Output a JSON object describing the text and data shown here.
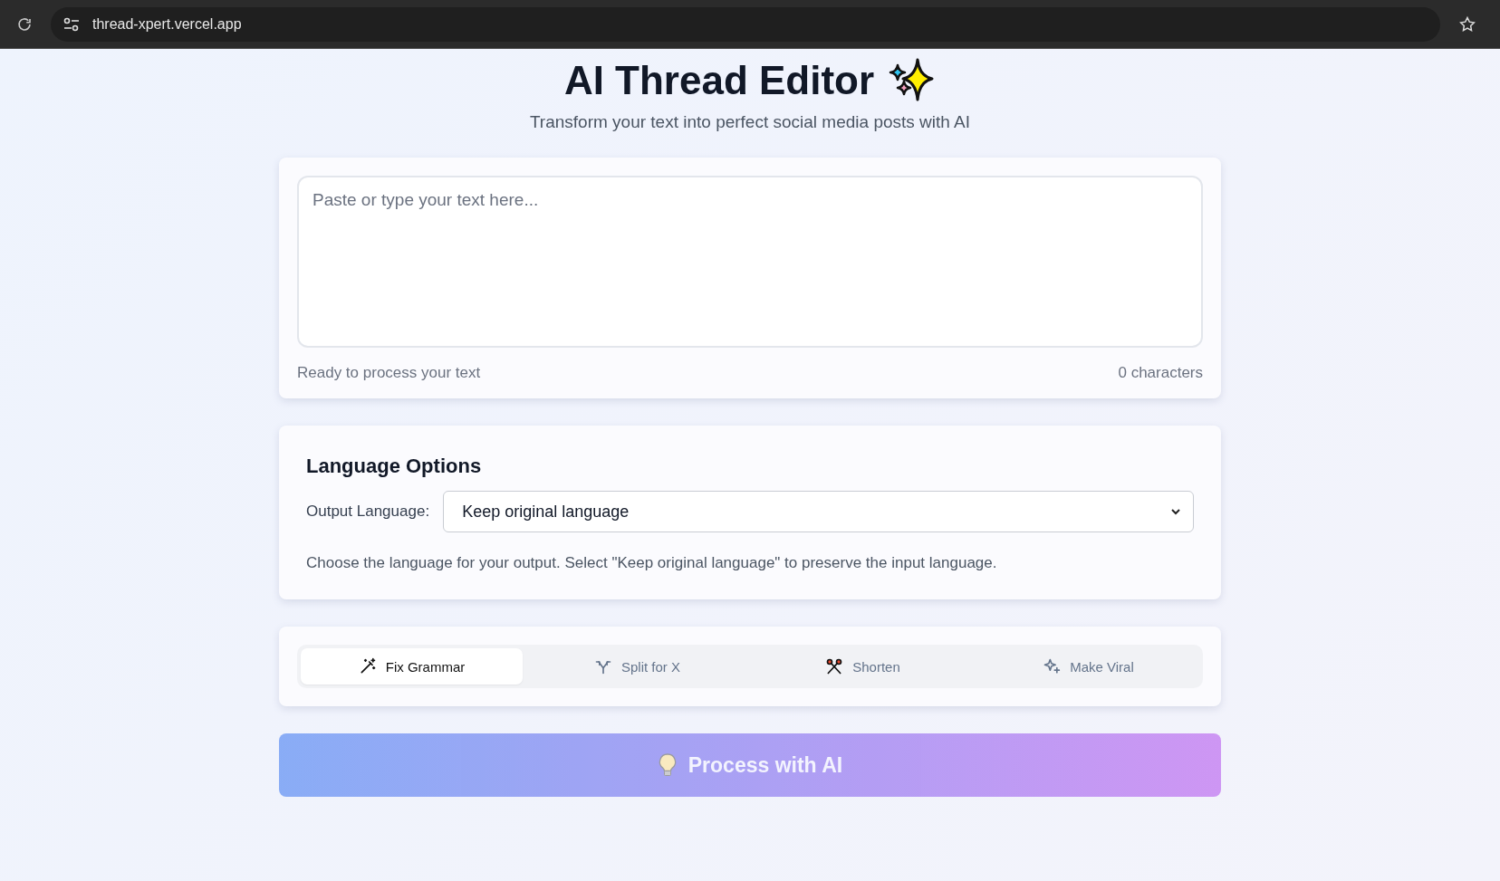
{
  "browser": {
    "url": "thread-xpert.vercel.app"
  },
  "header": {
    "title": "AI Thread Editor",
    "subtitle": "Transform your text into perfect social media posts with AI"
  },
  "editor": {
    "placeholder": "Paste or type your text here...",
    "status": "Ready to process your text",
    "count": "0 characters"
  },
  "language": {
    "heading": "Language Options",
    "label": "Output Language:",
    "value": "Keep original language",
    "help": "Choose the language for your output. Select \"Keep original language\" to preserve the input language."
  },
  "modes": [
    {
      "label": "Fix Grammar",
      "kind": "wand",
      "selected": true
    },
    {
      "label": "Split for X",
      "kind": "split",
      "selected": false
    },
    {
      "label": "Shorten",
      "kind": "scissors",
      "selected": false
    },
    {
      "label": "Make Viral",
      "kind": "sparkle",
      "selected": false
    }
  ],
  "process": {
    "label": "Process with AI",
    "disabled": true
  }
}
